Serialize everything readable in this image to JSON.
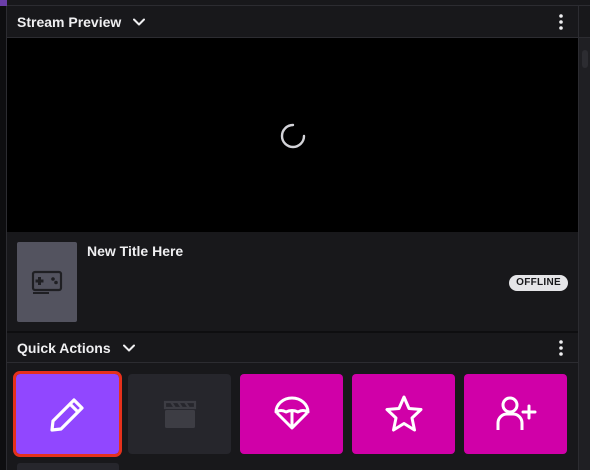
{
  "stream_preview": {
    "header_title": "Stream Preview",
    "stream_title": "New Title Here",
    "status_badge": "OFFLINE"
  },
  "quick_actions": {
    "header_title": "Quick Actions",
    "tiles": [
      {
        "icon": "pencil-icon",
        "color": "#9147ff",
        "selected": true
      },
      {
        "icon": "clapperboard-icon",
        "color": "#26262c",
        "disabled": true
      },
      {
        "icon": "parachute-icon",
        "color": "#d000a8"
      },
      {
        "icon": "star-icon",
        "color": "#d000a8"
      },
      {
        "icon": "add-user-icon",
        "color": "#d000a8"
      }
    ]
  },
  "colors": {
    "accent_purple": "#9147ff",
    "magenta": "#d000a8",
    "selection_outline": "#e5311c",
    "panel_bg": "#18181b"
  }
}
